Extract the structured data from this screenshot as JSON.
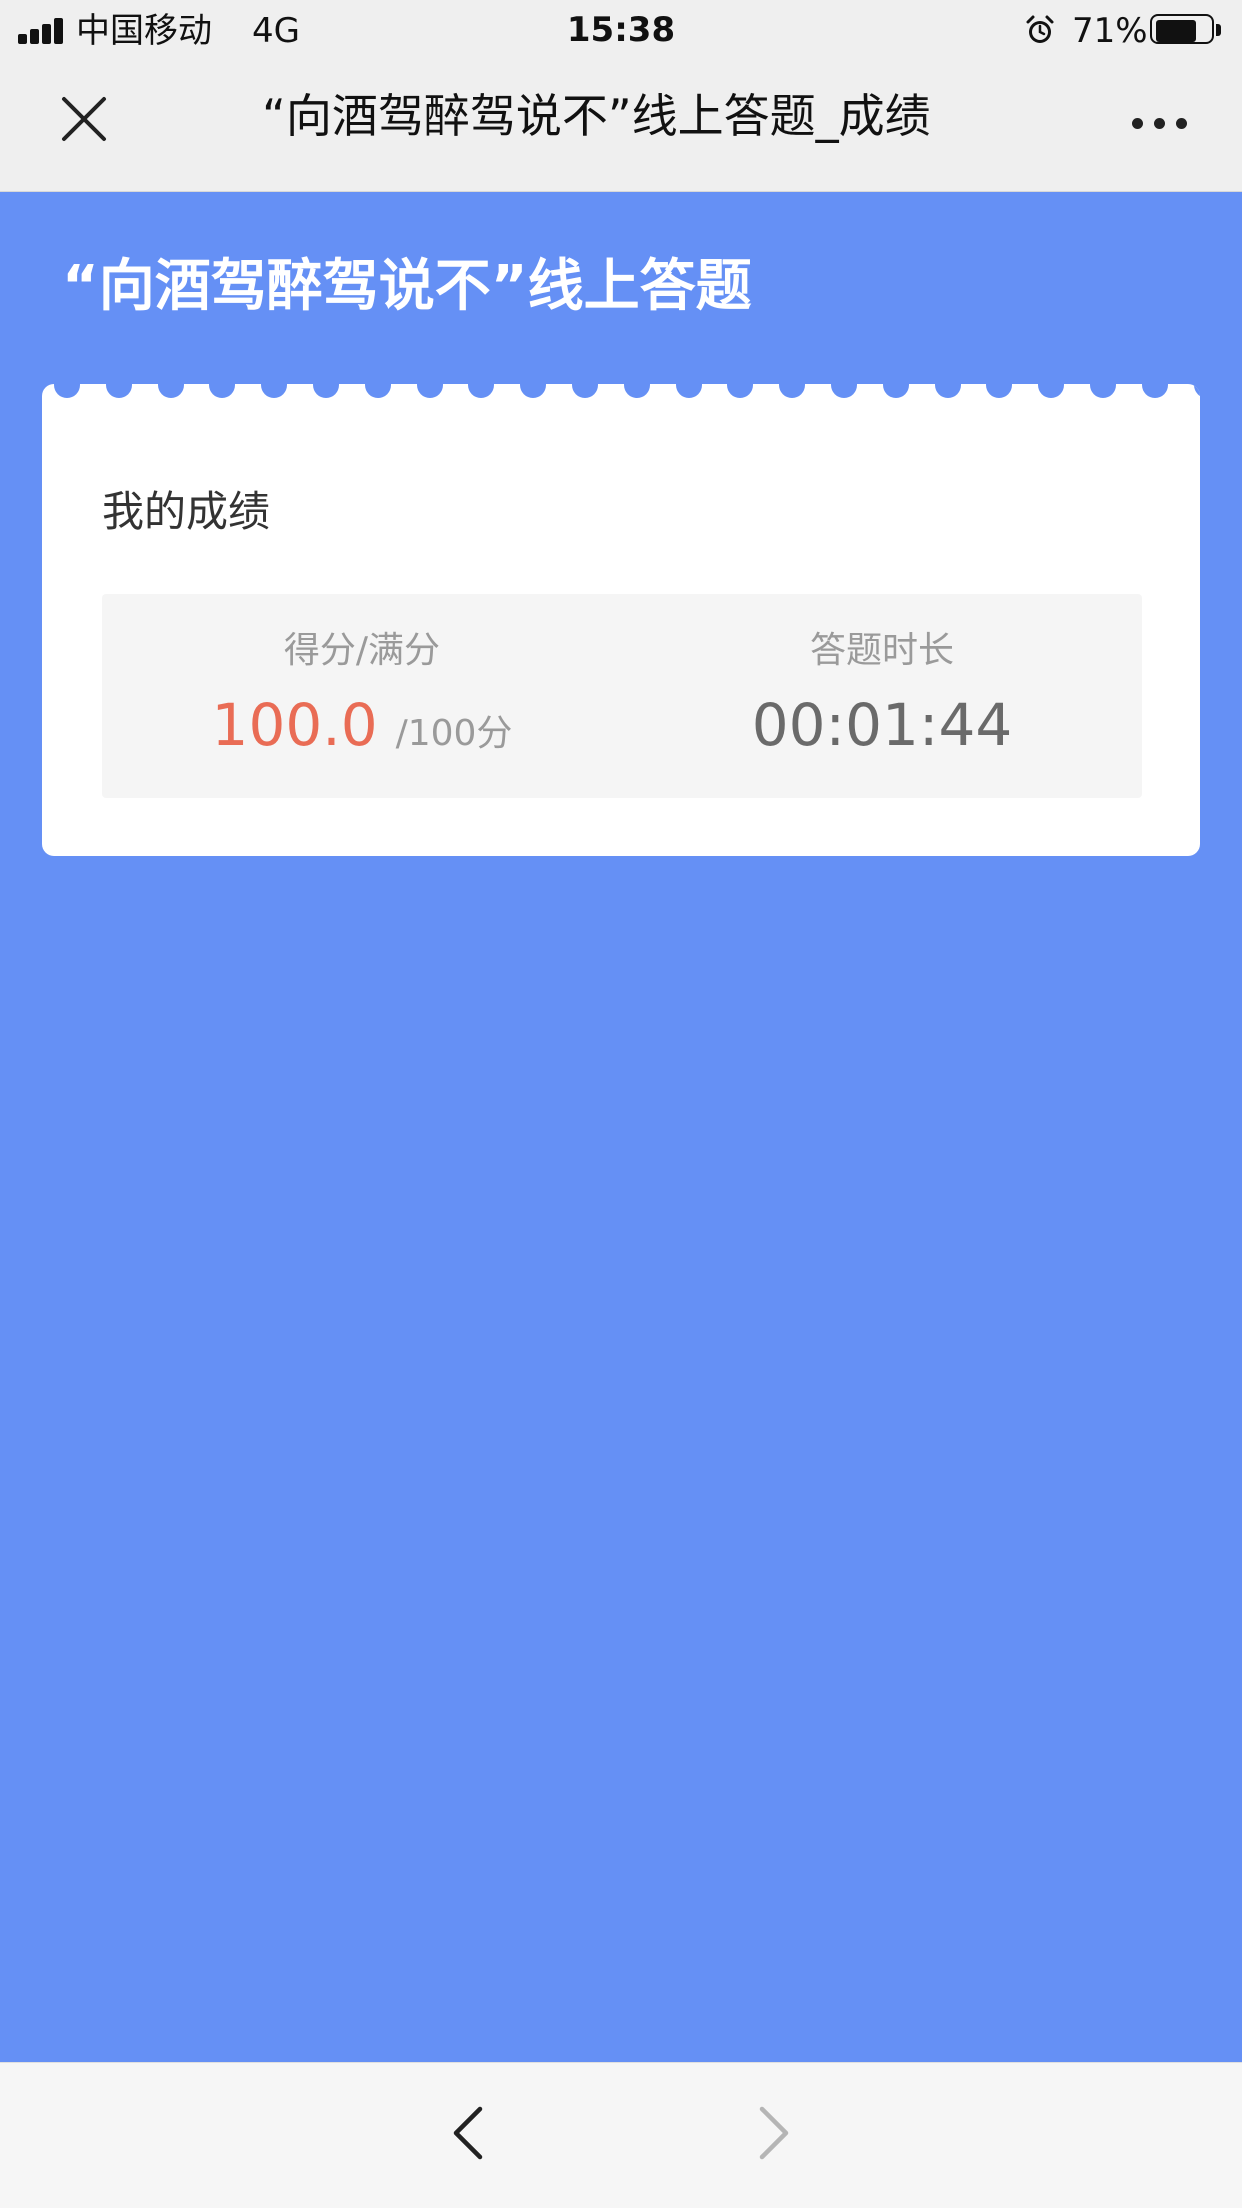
{
  "status_bar": {
    "carrier": "中国移动",
    "network": "4G",
    "time": "15:38",
    "battery_percent": "71%",
    "battery_level": 0.71,
    "icons": [
      "signal-icon",
      "alarm-icon",
      "battery-icon"
    ]
  },
  "nav": {
    "title": "“向酒驾醉驾说不”线上答题_成绩",
    "close_icon": "close-icon",
    "more_icon": "more-icon"
  },
  "page": {
    "title": "“向酒驾醉驾说不”线上答题"
  },
  "result_card": {
    "heading": "我的成绩",
    "score_label": "得分/满分",
    "score_value": "100.0",
    "score_total": "/100分",
    "duration_label": "答题时长",
    "duration_value": "00:01:44"
  },
  "toolbar": {
    "back_icon": "chevron-left-icon",
    "forward_icon": "chevron-right-icon"
  },
  "colors": {
    "background": "#6590f5",
    "score": "#e96c55",
    "card": "#ffffff",
    "stats_box": "#f5f5f5"
  }
}
